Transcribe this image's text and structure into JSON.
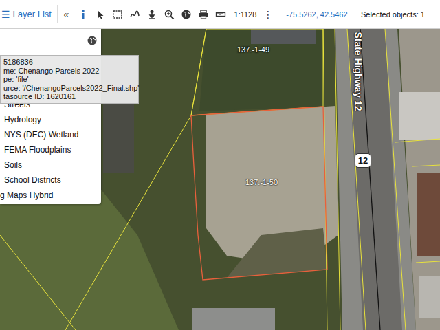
{
  "toolbar": {
    "menu_icon": "☰",
    "layer_list": "Layer List",
    "collapse": "«",
    "scale": "1:1128",
    "more": "⋮",
    "coordinates": "-75.5262, 42.5462",
    "selected_objects": "Selected objects: 1"
  },
  "layer_panel": {
    "items": [
      {
        "label": "Streets"
      },
      {
        "label": "Hydrology"
      },
      {
        "label": "NYS (DEC) Wetland"
      },
      {
        "label": "FEMA Floodplains"
      },
      {
        "label": "Soils"
      },
      {
        "label": "School Districts"
      },
      {
        "label": "g Maps Hybrid"
      }
    ]
  },
  "tooltip": {
    "lines": [
      "5186836",
      "me: Chenango Parcels 2022",
      "pe: 'file'",
      "urce: '/ChenangoParcels2022_Final.shp'",
      "tasource ID: 1620161"
    ]
  },
  "map": {
    "parcels": [
      {
        "label": "137.-1-49",
        "selected": false
      },
      {
        "label": "137.-1-50",
        "selected": true
      }
    ],
    "road_label": "State Highway 12",
    "route_shield": "12"
  }
}
